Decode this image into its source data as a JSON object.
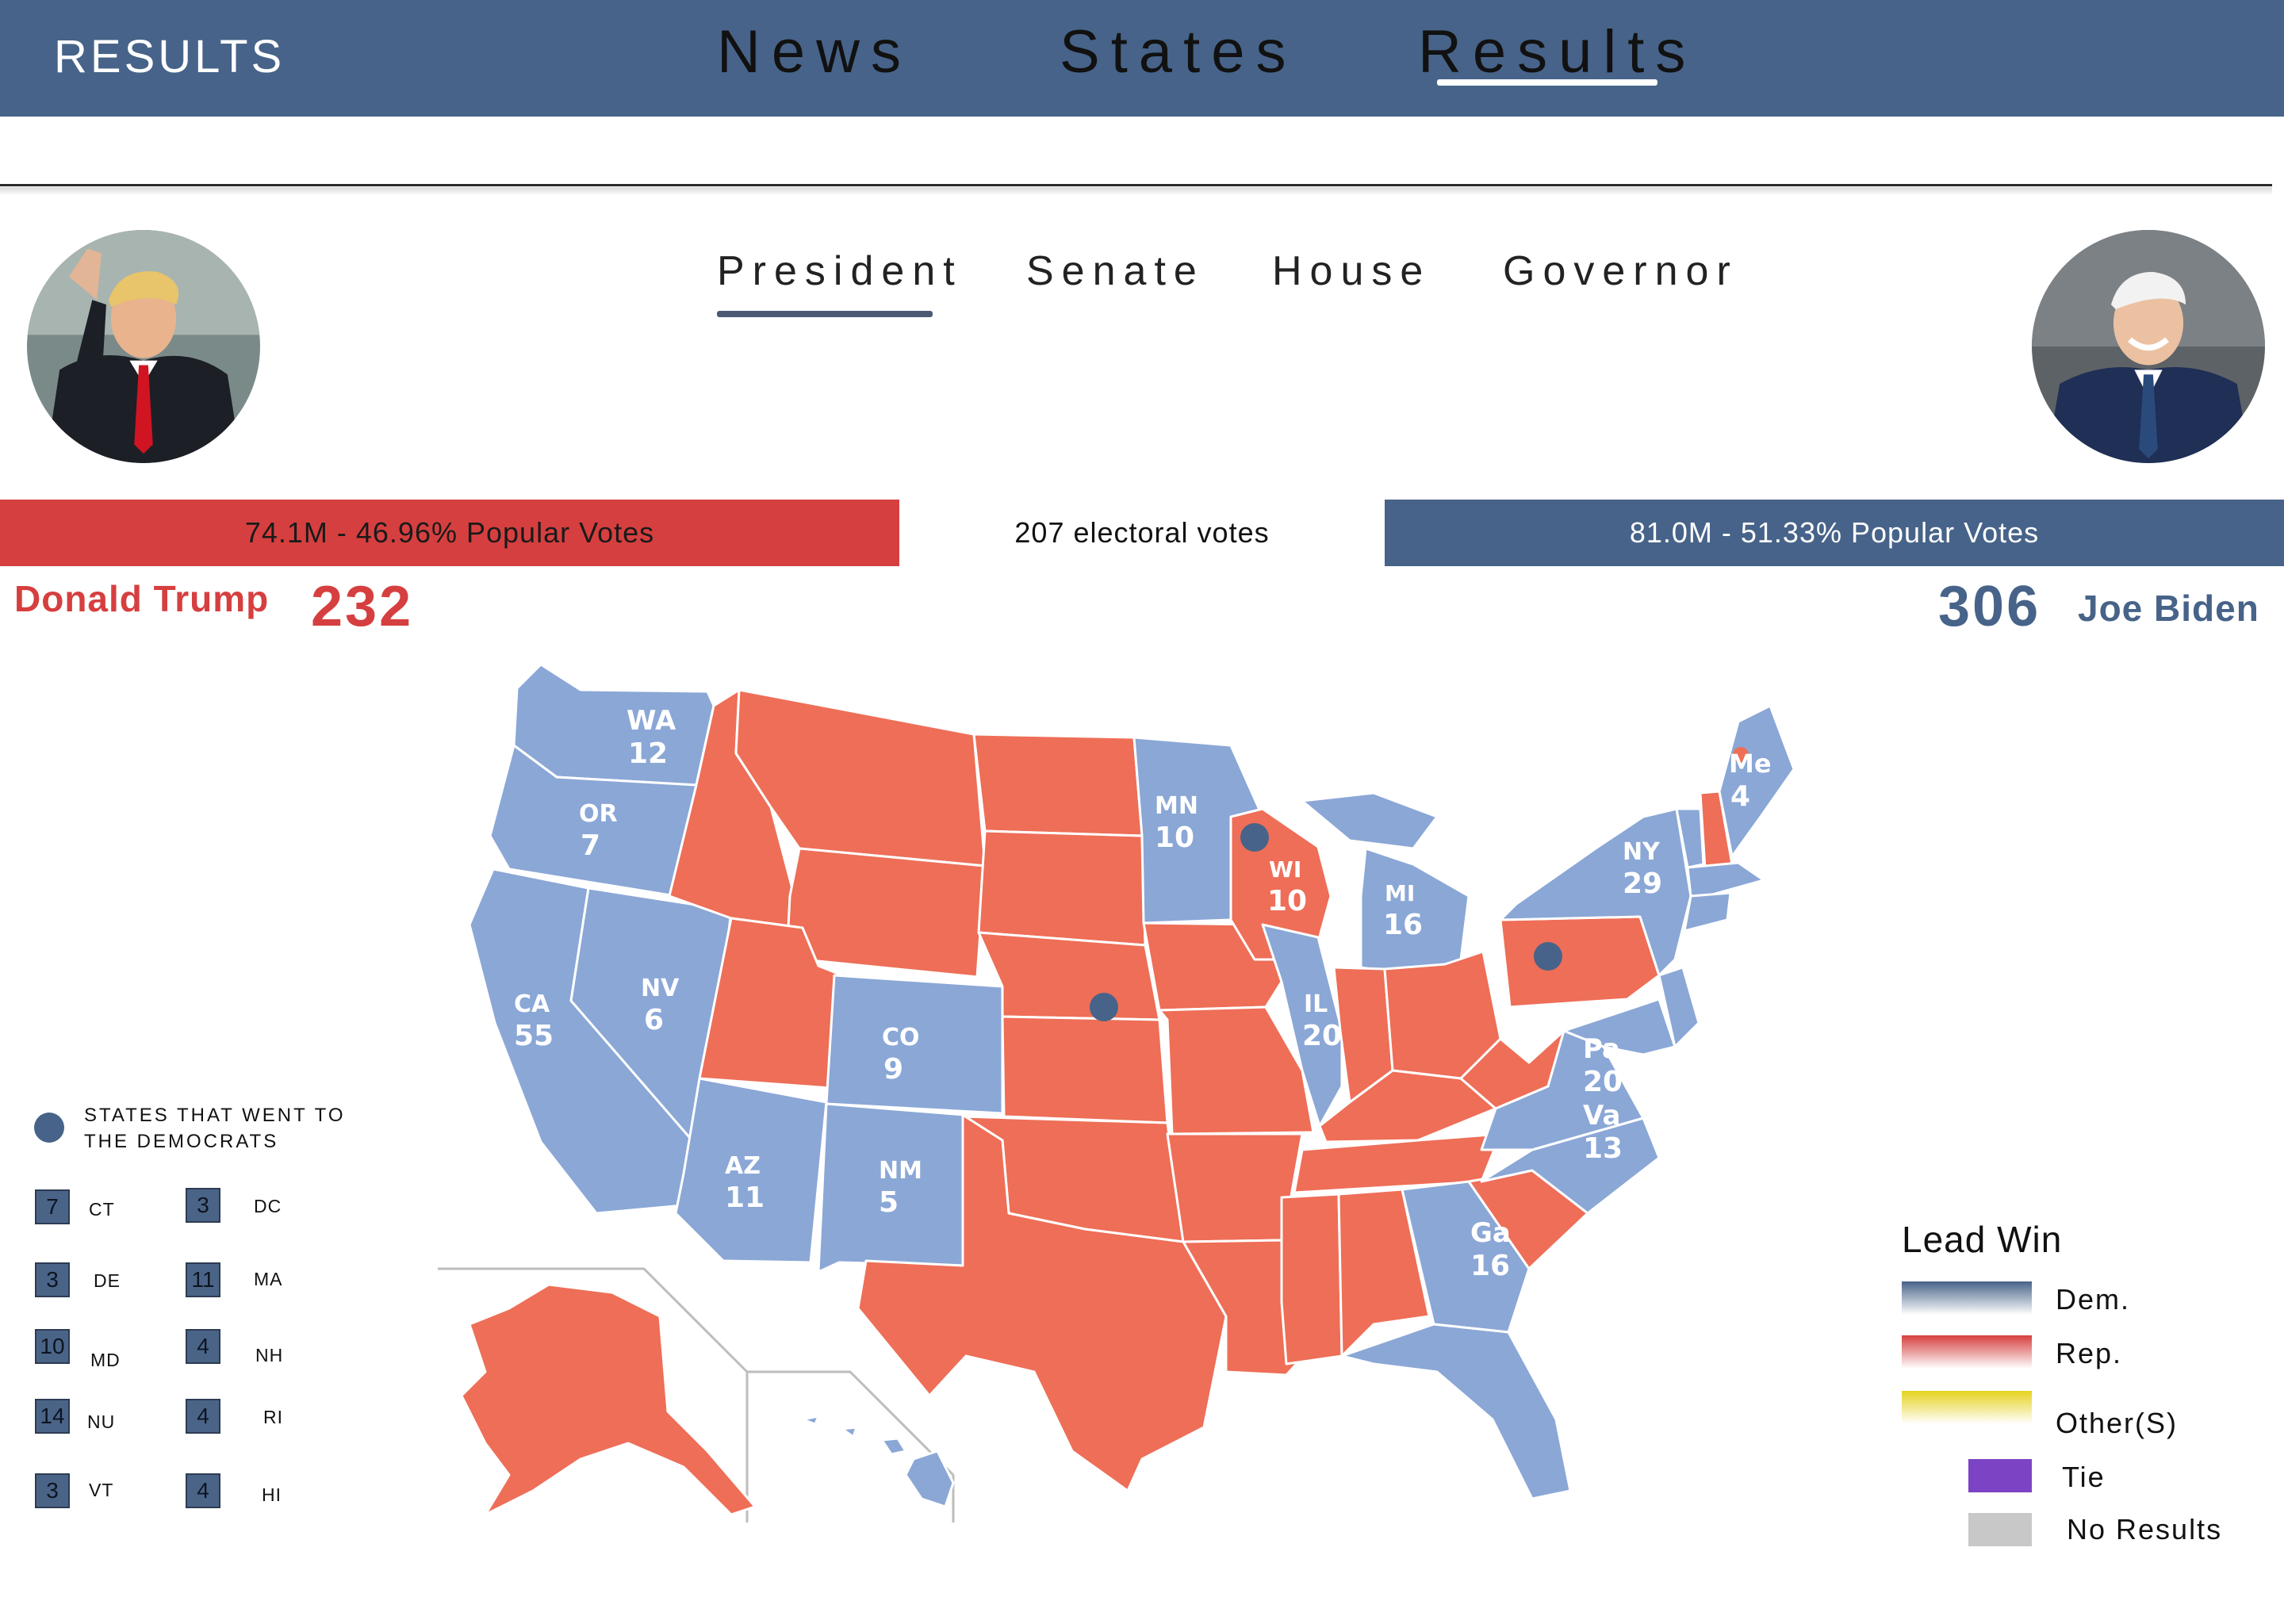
{
  "header": {
    "brand": "RESULTS",
    "nav": [
      "News",
      "States",
      "Results"
    ],
    "active_nav": "Results",
    "background_color": "#476389"
  },
  "tabs": {
    "items": [
      "President",
      "Senate",
      "House",
      "Governor"
    ],
    "active": "President"
  },
  "republican": {
    "name": "Donald Trump",
    "electoral_votes": "232",
    "popular_votes": "74.1M - 46.96% Popular Votes",
    "color": "#d63f3f"
  },
  "democrat": {
    "name": "Joe Biden",
    "electoral_votes": "306",
    "popular_votes": "81.0M - 51.33% Popular Votes",
    "color": "#476389"
  },
  "center_label": "207 electoral votes",
  "map": {
    "state_labels": {
      "wa": {
        "abbr": "WA",
        "votes": "12"
      },
      "or": {
        "abbr": "OR",
        "votes": "7"
      },
      "ca": {
        "abbr": "CA",
        "votes": "55"
      },
      "nv": {
        "abbr": "NV",
        "votes": "6"
      },
      "az": {
        "abbr": "AZ",
        "votes": "11"
      },
      "co": {
        "abbr": "CO",
        "votes": "9"
      },
      "nm": {
        "abbr": "NM",
        "votes": "5"
      },
      "mn": {
        "abbr": "MN",
        "votes": "10"
      },
      "wi": {
        "abbr": "WI",
        "votes": "10"
      },
      "mi": {
        "abbr": "MI",
        "votes": "16"
      },
      "il": {
        "abbr": "IL",
        "votes": "20"
      },
      "ny": {
        "abbr": "NY",
        "votes": "29"
      },
      "me": {
        "abbr": "Me",
        "votes": "4"
      },
      "pa": {
        "abbr": "Pa",
        "votes": "20"
      },
      "va": {
        "abbr": "Va",
        "votes": "13"
      },
      "ga": {
        "abbr": "Ga",
        "votes": "16"
      }
    },
    "colors": {
      "dem": "#8aa7d6",
      "rep": "#ee6e57",
      "dot": "#476389"
    }
  },
  "democrat_states_legend": {
    "title": "STATES THAT WENT TO THE DEMOCRATS",
    "left_column": [
      {
        "votes": "7",
        "state": "CT"
      },
      {
        "votes": "3",
        "state": "DE"
      },
      {
        "votes": "10",
        "state": "MD"
      },
      {
        "votes": "14",
        "state": "NU"
      },
      {
        "votes": "3",
        "state": "VT"
      }
    ],
    "right_column": [
      {
        "votes": "3",
        "state": "DC"
      },
      {
        "votes": "11",
        "state": "MA"
      },
      {
        "votes": "4",
        "state": "NH"
      },
      {
        "votes": "4",
        "state": "RI"
      },
      {
        "votes": "4",
        "state": "HI"
      }
    ]
  },
  "lead_win_legend": {
    "title": "Lead Win",
    "items": [
      {
        "label": "Dem.",
        "color": "#476389"
      },
      {
        "label": "Rep.",
        "color": "#d63f3f"
      },
      {
        "label": "Other(S)",
        "color": "#e6d21f"
      },
      {
        "label": "Tie",
        "color": "#7c44c4"
      },
      {
        "label": "No Results",
        "color": "#c8c8c8"
      }
    ]
  }
}
